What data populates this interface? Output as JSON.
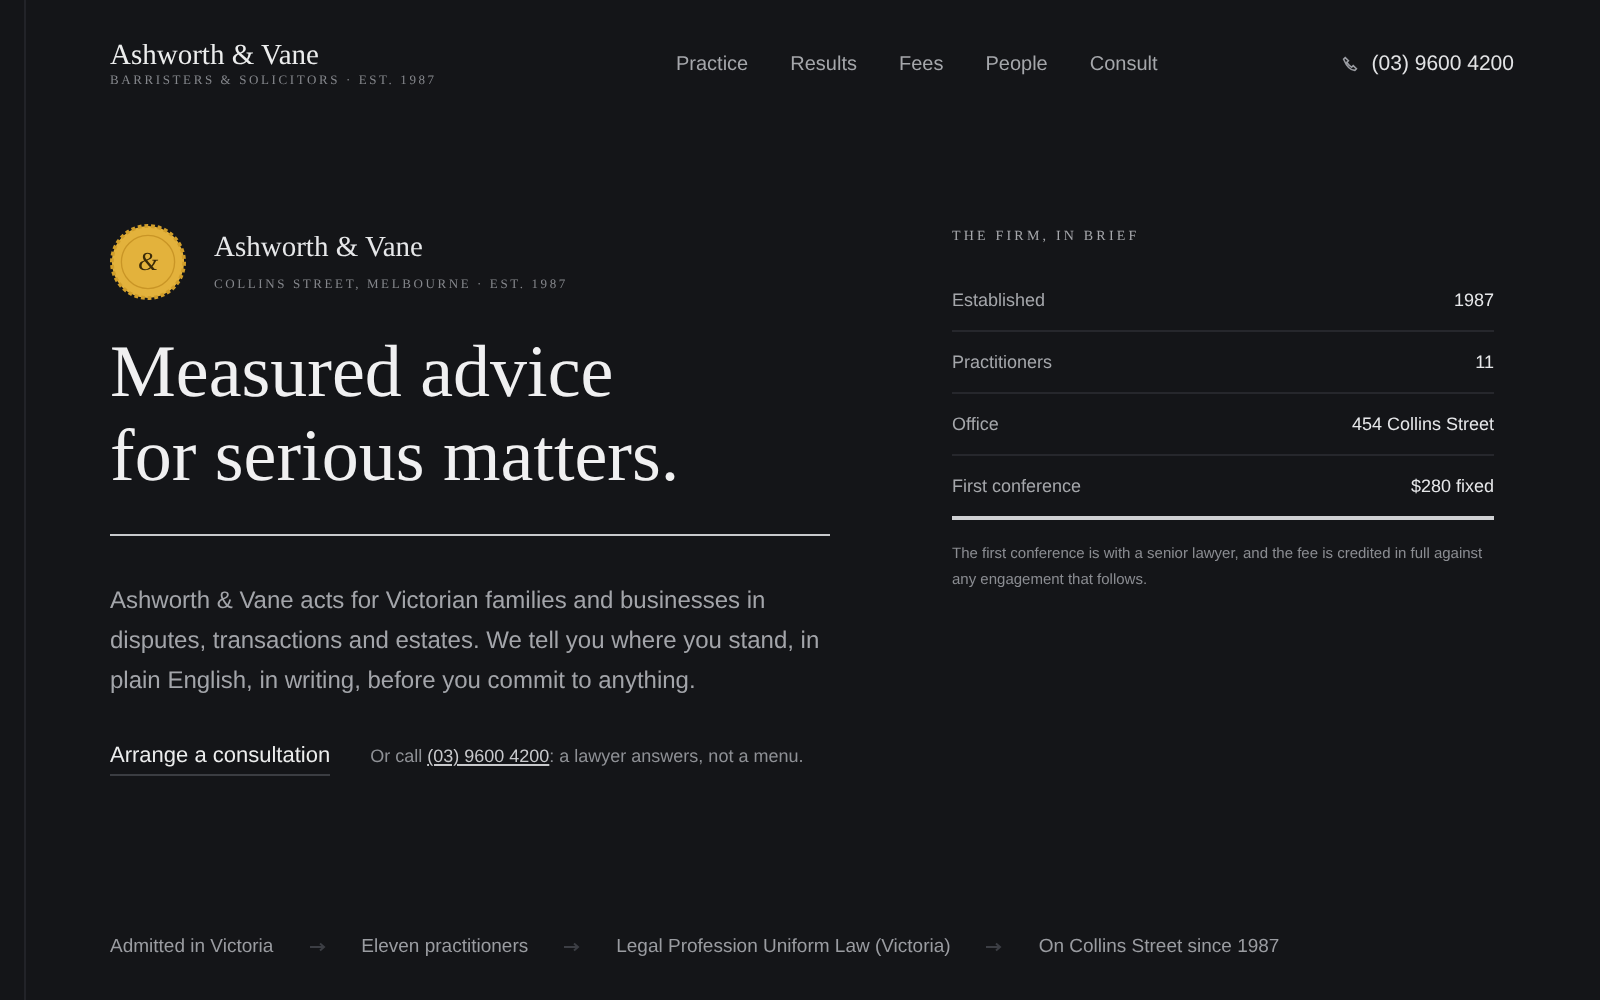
{
  "header": {
    "brand": "Ashworth & Vane",
    "tagline": "BARRISTERS & SOLICITORS · EST. 1987",
    "nav": [
      {
        "label": "Practice"
      },
      {
        "label": "Results"
      },
      {
        "label": "Fees"
      },
      {
        "label": "People"
      },
      {
        "label": "Consult"
      }
    ],
    "phone": "(03) 9600 4200"
  },
  "hero": {
    "seal": "&",
    "name": "Ashworth & Vane",
    "address": "COLLINS STREET, MELBOURNE · EST. 1987",
    "headline": [
      "Measured advice",
      "for serious matters."
    ],
    "intro": "Ashworth & Vane acts for Victorian families and businesses in disputes, transactions and estates. We tell you where you stand, in plain English, in writing, before you commit to anything.",
    "cta": "Arrange a consultation",
    "call_prefix": "Or call",
    "call_phone": "(03) 9600 4200",
    "call_suffix": ": a lawyer answers, not a menu."
  },
  "brief": {
    "title": "THE FIRM, IN BRIEF",
    "rows": [
      {
        "label": "Established",
        "value": "1987"
      },
      {
        "label": "Practitioners",
        "value": "11"
      },
      {
        "label": "Office",
        "value": "454 Collins Street"
      },
      {
        "label": "First conference",
        "value": "$280 fixed"
      }
    ],
    "note": "The first conference is with a senior lawyer, and the fee is credited in full against any engagement that follows."
  },
  "footer": [
    "Admitted in Victoria",
    "Eleven practitioners",
    "Legal Profession Uniform Law (Victoria)",
    "On Collins Street since 1987"
  ]
}
